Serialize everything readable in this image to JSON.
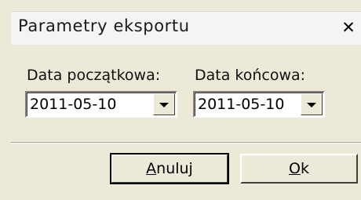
{
  "window": {
    "title": "Parametry eksportu",
    "close_glyph": "✕"
  },
  "fields": {
    "start_label": "Data początkowa:",
    "start_value": "2011-05-10",
    "end_label": "Data końcowa:",
    "end_value": "2011-05-10"
  },
  "buttons": {
    "cancel_mnemonic": "A",
    "cancel_rest": "nuluj",
    "ok_mnemonic": "O",
    "ok_rest": "k"
  },
  "icons": {
    "close": "close-icon",
    "dropdown": "chevron-down-icon"
  }
}
